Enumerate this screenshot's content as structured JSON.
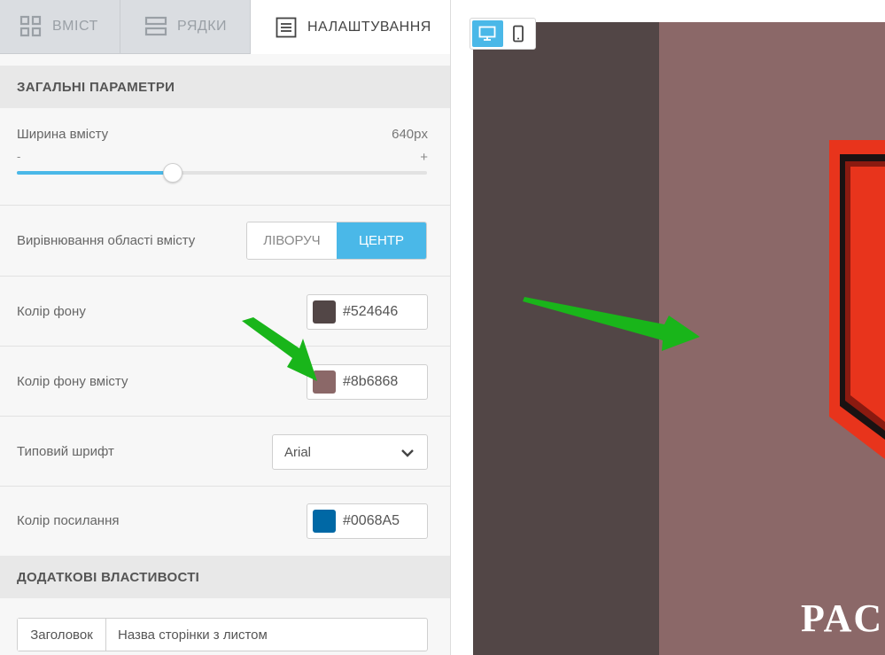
{
  "tabs": [
    {
      "label": "ВМІСТ",
      "icon": "grid-icon"
    },
    {
      "label": "РЯДКИ",
      "icon": "rows-icon"
    },
    {
      "label": "НАЛАШТУВАННЯ",
      "icon": "settings-list-icon"
    }
  ],
  "general": {
    "heading": "ЗАГАЛЬНІ ПАРАМЕТРИ",
    "content_width": {
      "label": "Ширина вмісту",
      "value": "640px",
      "min_label": "-",
      "max_label": "+",
      "fraction": 0.38
    },
    "alignment": {
      "label": "Вирівнювання області вмісту",
      "options": [
        "ЛІВОРУЧ",
        "ЦЕНТР"
      ],
      "selected": "ЦЕНТР"
    },
    "bg_color": {
      "label": "Колір фону",
      "value": "#524646"
    },
    "content_bg_color": {
      "label": "Колір фону вмісту",
      "value": "#8b6868"
    },
    "default_font": {
      "label": "Типовий шрифт",
      "value": "Arial"
    },
    "link_color": {
      "label": "Колір посилання",
      "value": "#0068A5"
    }
  },
  "extra": {
    "heading": "ДОДАТКОВІ ВЛАСТИВОСТІ",
    "title_field": {
      "addon": "Заголовок",
      "value": "Назва сторінки з листом"
    }
  },
  "preview": {
    "devices": [
      "desktop-icon",
      "mobile-icon"
    ],
    "selected_device": "desktop-icon",
    "text": "PAC",
    "emblem_colors": {
      "outer": "#e8341c",
      "inner": "#1a1212"
    }
  },
  "colors": {
    "accent": "#4ab8e8",
    "arrow": "#19b51a"
  }
}
